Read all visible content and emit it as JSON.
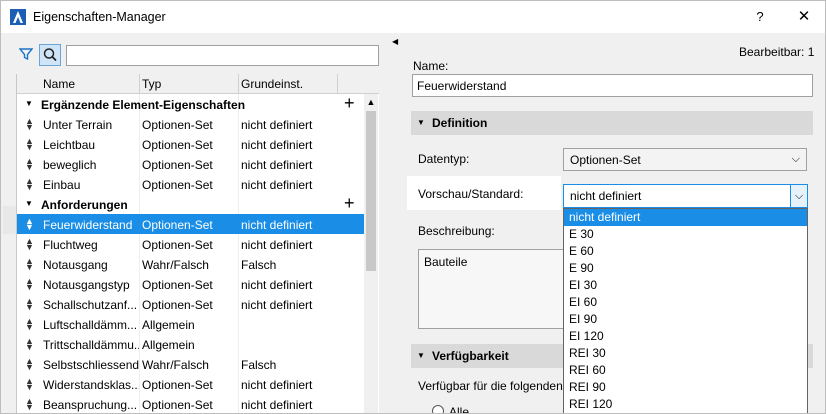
{
  "window": {
    "title": "Eigenschaften-Manager",
    "help_label": "?",
    "close_label": "✕"
  },
  "search": {
    "placeholder": "",
    "value": ""
  },
  "list": {
    "columns": [
      "Name",
      "Typ",
      "Grundeinst."
    ],
    "rows": [
      {
        "kind": "group",
        "label": "Ergänzende Element-Eigenschaften"
      },
      {
        "kind": "item",
        "name": "Unter Terrain",
        "type": "Optionen-Set",
        "default": "nicht definiert"
      },
      {
        "kind": "item",
        "name": "Leichtbau",
        "type": "Optionen-Set",
        "default": "nicht definiert"
      },
      {
        "kind": "item",
        "name": "beweglich",
        "type": "Optionen-Set",
        "default": "nicht definiert"
      },
      {
        "kind": "item",
        "name": "Einbau",
        "type": "Optionen-Set",
        "default": "nicht definiert"
      },
      {
        "kind": "group",
        "label": "Anforderungen"
      },
      {
        "kind": "item",
        "name": "Feuerwiderstand",
        "type": "Optionen-Set",
        "default": "nicht definiert",
        "selected": true
      },
      {
        "kind": "item",
        "name": "Fluchtweg",
        "type": "Optionen-Set",
        "default": "nicht definiert"
      },
      {
        "kind": "item",
        "name": "Notausgang",
        "type": "Wahr/Falsch",
        "default": "Falsch"
      },
      {
        "kind": "item",
        "name": "Notausgangstyp",
        "type": "Optionen-Set",
        "default": "nicht definiert"
      },
      {
        "kind": "item",
        "name": "Schallschutzanf...",
        "type": "Optionen-Set",
        "default": "nicht definiert"
      },
      {
        "kind": "item",
        "name": "Luftschalldämm...",
        "type": "Allgemein",
        "default": ""
      },
      {
        "kind": "item",
        "name": "Trittschalldämmu...",
        "type": "Allgemein",
        "default": ""
      },
      {
        "kind": "item",
        "name": "Selbstschliessend",
        "type": "Wahr/Falsch",
        "default": "Falsch"
      },
      {
        "kind": "item",
        "name": "Widerstandsklas...",
        "type": "Optionen-Set",
        "default": "nicht definiert"
      },
      {
        "kind": "item",
        "name": "Beanspruchung...",
        "type": "Optionen-Set",
        "default": "nicht definiert"
      }
    ]
  },
  "detail": {
    "editable_label": "Bearbeitbar: 1",
    "name_label": "Name:",
    "name_value": "Feuerwiderstand",
    "definition_section": "Definition",
    "datentyp_label": "Datentyp:",
    "datentyp_value": "Optionen-Set",
    "vorschau_label": "Vorschau/Standard:",
    "vorschau_value": "nicht definiert",
    "beschreibung_label": "Beschreibung:",
    "beschreibung_value": "Bauteile",
    "verfuegbarkeit_section": "Verfügbarkeit",
    "verfuegbar_text": "Verfügbar für die folgenden",
    "alle_label": "Alle"
  },
  "dropdown": {
    "options": [
      "nicht definiert",
      "E 30",
      "E 60",
      "E 90",
      "EI 30",
      "EI 60",
      "EI 90",
      "EI 120",
      "REI 30",
      "REI 60",
      "REI 90",
      "REI 120"
    ],
    "selected_index": 0
  },
  "colors": {
    "selection": "#1a8ee6",
    "section_header": "#d9d9d9"
  }
}
